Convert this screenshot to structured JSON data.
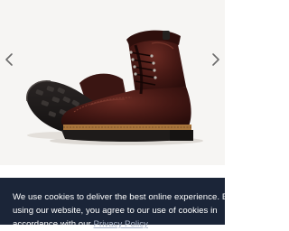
{
  "carousel": {
    "product_image_alt": "leather work boot",
    "prev_icon": "chevron-left-icon",
    "next_icon": "chevron-right-icon"
  },
  "cookie_banner": {
    "line1": "We use cookies to deliver the best online experience. By",
    "line2": "using our website, you agree to our use of cookies in",
    "line3_prefix": "accordance with our ",
    "privacy_link": "Privacy Policy"
  },
  "colors": {
    "carousel_bg": "#f6f5f3",
    "banner_bg": "#1b2538",
    "leather": "#3d1512",
    "sole": "#1e1b1a",
    "welt": "#a9753c"
  }
}
